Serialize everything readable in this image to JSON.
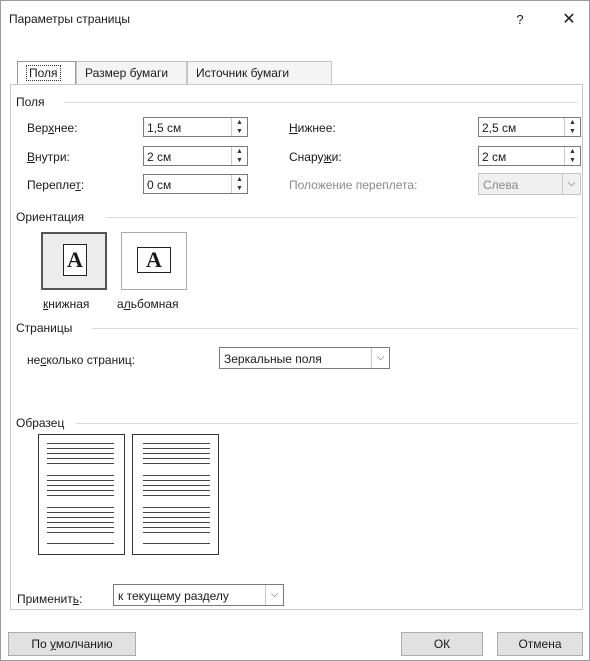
{
  "dialog": {
    "title": "Параметры страницы",
    "help": "?",
    "close": "✕"
  },
  "tabs": [
    "Поля",
    "Размер бумаги",
    "Источник бумаги"
  ],
  "margins": {
    "section": "Поля",
    "top": {
      "pre": "Вер",
      "u": "х",
      "post": "нее:",
      "value": "1,5 см"
    },
    "bottom": {
      "pre": "",
      "u": "Н",
      "post": "ижнее:",
      "value": "2,5 см"
    },
    "inside": {
      "pre": "",
      "u": "В",
      "post": "нутри:",
      "value": "2 см"
    },
    "outside": {
      "pre": "Снару",
      "u": "ж",
      "post": "и:",
      "value": "2 см"
    },
    "gutter": {
      "pre": "Перепле",
      "u": "т",
      "post": ":",
      "value": "0 см"
    },
    "gutter_pos": {
      "label": "Положение переплета:",
      "value": "Слева"
    }
  },
  "orientation": {
    "section": "Ориентация",
    "glyph": "A",
    "portrait": {
      "u": "к",
      "post": "нижная"
    },
    "landscape": {
      "pre": "а",
      "u": "л",
      "post": "ьбомная"
    }
  },
  "pages": {
    "section": "Страницы",
    "pre": "не",
    "u": "с",
    "post": "колько страниц:",
    "value": "Зеркальные поля"
  },
  "sample": {
    "section": "Образец"
  },
  "apply": {
    "pre": "Применит",
    "u": "ь",
    "post": ":",
    "value": "к текущему разделу"
  },
  "buttons": {
    "default_pre": "По ",
    "default_u": "у",
    "default_post": "молчанию",
    "ok": "ОК",
    "cancel": "Отмена"
  },
  "icons": {
    "spin_up": "spin-up-icon",
    "spin_down": "spin-down-icon",
    "dropdown": "chevron-down-icon"
  }
}
